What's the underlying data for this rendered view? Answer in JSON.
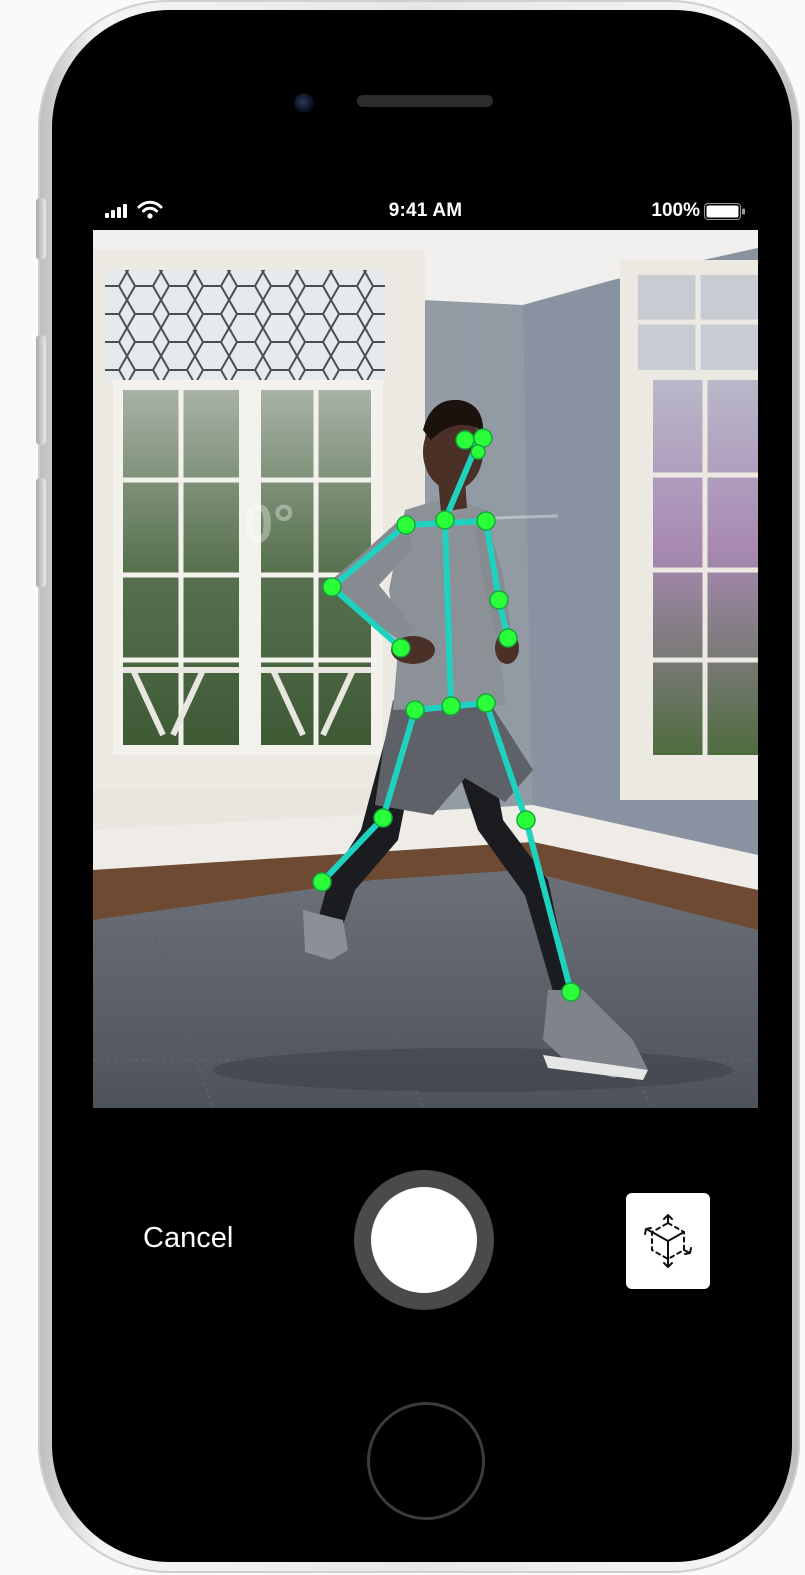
{
  "status_bar": {
    "time": "9:41 AM",
    "battery_percent": "100%",
    "signal_icon": "cellular-signal-icon",
    "wifi_icon": "wifi-icon",
    "battery_icon": "battery-icon"
  },
  "camera": {
    "overlay_text": "0°",
    "skeleton_color": "#1fd2bf",
    "joint_color": "#2bff3a"
  },
  "controls": {
    "cancel_label": "Cancel",
    "shutter_icon": "shutter-button",
    "ar_icon": "ar-cube-icon"
  }
}
